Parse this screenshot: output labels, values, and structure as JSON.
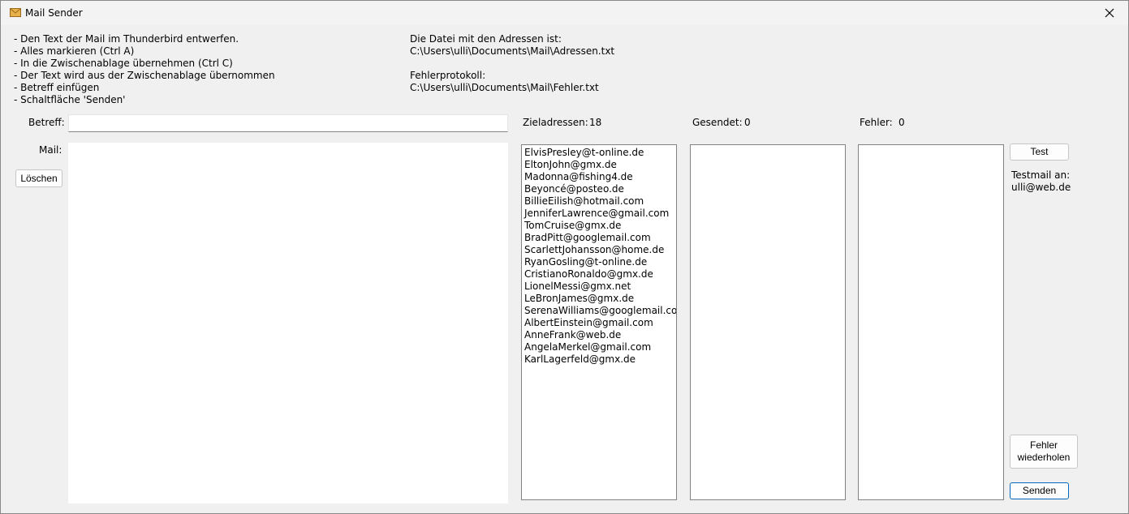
{
  "window": {
    "title": "Mail Sender"
  },
  "instructions": [
    "- Den Text der Mail im Thunderbird entwerfen.",
    "- Alles markieren (Ctrl A)",
    "- In die Zwischenablage übernehmen (Ctrl C)",
    "- Der Text wird aus der Zwischenablage übernommen",
    "- Betreff einfügen",
    "- Schaltfläche 'Senden'"
  ],
  "fileinfo": {
    "address_label": "Die Datei mit den Adressen ist:",
    "address_path": "C:\\Users\\ulli\\Documents\\Mail\\Adressen.txt",
    "errorlog_label": "Fehlerprotokoll:",
    "errorlog_path": "C:\\Users\\ulli\\Documents\\Mail\\Fehler.txt"
  },
  "form": {
    "subject_label": "Betreff:",
    "subject_value": "",
    "mail_label": "Mail:",
    "mail_value": "",
    "clear_button": "Löschen"
  },
  "stats": {
    "targets_label": "Zieladressen:",
    "targets_count": "18",
    "sent_label": "Gesendet:",
    "sent_count": "0",
    "errors_label": "Fehler:",
    "errors_count": "0"
  },
  "target_addresses": [
    "ElvisPresley@t-online.de",
    "EltonJohn@gmx.de",
    "Madonna@fishing4.de",
    "Beyoncé@posteo.de",
    "BillieEilish@hotmail.com",
    "JenniferLawrence@gmail.com",
    "TomCruise@gmx.de",
    "BradPitt@googlemail.com",
    "ScarlettJohansson@home.de",
    "RyanGosling@t-online.de",
    "CristianoRonaldo@gmx.de",
    "LionelMessi@gmx.net",
    "LeBronJames@gmx.de",
    "SerenaWilliams@googlemail.com",
    "AlbertEinstein@gmail.com",
    "AnneFrank@web.de",
    "AngelaMerkel@gmail.com",
    "KarlLagerfeld@gmx.de"
  ],
  "actions": {
    "test_button": "Test",
    "testmail_label": "Testmail an:",
    "testmail_address": "ulli@web.de",
    "retry_line1": "Fehler",
    "retry_line2": "wiederholen",
    "send_button": "Senden"
  },
  "colors": {
    "accent": "#0067c0",
    "window_bg": "#f0f0f0"
  },
  "icons": {
    "app": "envelope-icon",
    "close": "close-icon"
  }
}
